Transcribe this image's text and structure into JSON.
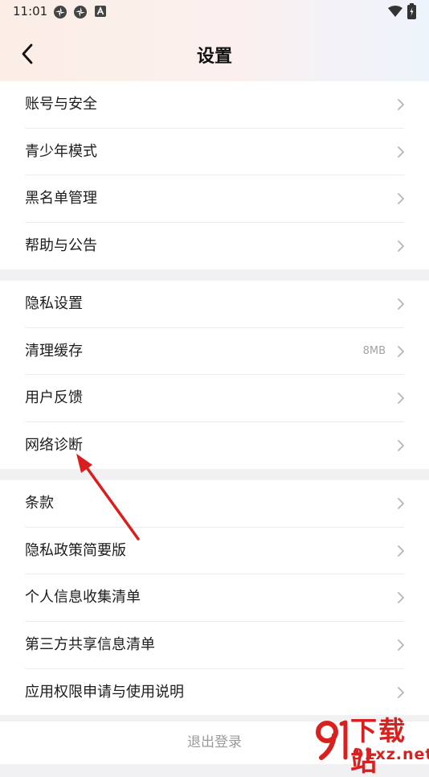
{
  "status_bar": {
    "time": "11:01",
    "left_icons": [
      "app-badge-icon",
      "app-badge-icon",
      "a-letter-icon"
    ],
    "right_icons": [
      "wifi-icon",
      "battery-icon"
    ]
  },
  "header": {
    "back_icon": "chevron-left-icon",
    "title": "设置"
  },
  "groups": [
    {
      "items": [
        {
          "label": "账号与安全",
          "extra": ""
        },
        {
          "label": "青少年模式",
          "extra": ""
        },
        {
          "label": "黑名单管理",
          "extra": ""
        },
        {
          "label": "帮助与公告",
          "extra": ""
        }
      ]
    },
    {
      "items": [
        {
          "label": "隐私设置",
          "extra": ""
        },
        {
          "label": "清理缓存",
          "extra": "8MB"
        },
        {
          "label": "用户反馈",
          "extra": ""
        },
        {
          "label": "网络诊断",
          "extra": ""
        }
      ]
    },
    {
      "items": [
        {
          "label": "条款",
          "extra": ""
        },
        {
          "label": "隐私政策简要版",
          "extra": ""
        },
        {
          "label": "个人信息收集清单",
          "extra": ""
        },
        {
          "label": "第三方共享信息清单",
          "extra": ""
        },
        {
          "label": "应用权限申请与使用说明",
          "extra": ""
        }
      ]
    }
  ],
  "logout_label": "退出登录",
  "watermark": {
    "brand": "下载站",
    "domain": "91xz.net",
    "logo_text": "91"
  },
  "colors": {
    "accent_red": "#d8201f",
    "annotation_arrow": "#d81e1e",
    "page_bg": "#f1f1f4",
    "chevron": "#b5b5b5"
  }
}
